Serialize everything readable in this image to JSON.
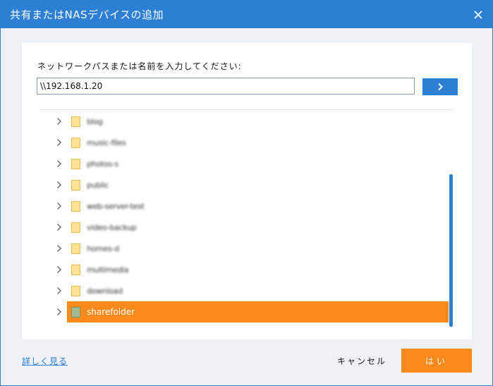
{
  "dialog": {
    "title": "共有またはNASデバイスの追加",
    "close_icon": "close-icon"
  },
  "path_panel": {
    "prompt": "ネットワークパスまたは名前を入力してください:",
    "path_value": "\\\\192.168.1.20",
    "go_icon": "chevron-right-icon"
  },
  "tree": {
    "items": [
      {
        "label": "blog",
        "icon": "folder-icon",
        "selected": false
      },
      {
        "label": "music-files",
        "icon": "folder-icon",
        "selected": false
      },
      {
        "label": "photos-s",
        "icon": "folder-icon",
        "selected": false
      },
      {
        "label": "public",
        "icon": "folder-icon",
        "selected": false
      },
      {
        "label": "web-server-test",
        "icon": "folder-icon",
        "selected": false
      },
      {
        "label": "video-backup",
        "icon": "folder-icon",
        "selected": false
      },
      {
        "label": "homes-d",
        "icon": "folder-icon",
        "selected": false
      },
      {
        "label": "multimedia",
        "icon": "folder-icon",
        "selected": false
      },
      {
        "label": "download",
        "icon": "folder-icon",
        "selected": false
      },
      {
        "label": "sharefolder",
        "icon": "folder-icon",
        "selected": true
      }
    ]
  },
  "footer": {
    "learn_more": "詳しく見る",
    "cancel": "キャンセル",
    "ok": "はい"
  },
  "colors": {
    "accent": "#2c7fd3",
    "selection": "#fb8a1b"
  }
}
